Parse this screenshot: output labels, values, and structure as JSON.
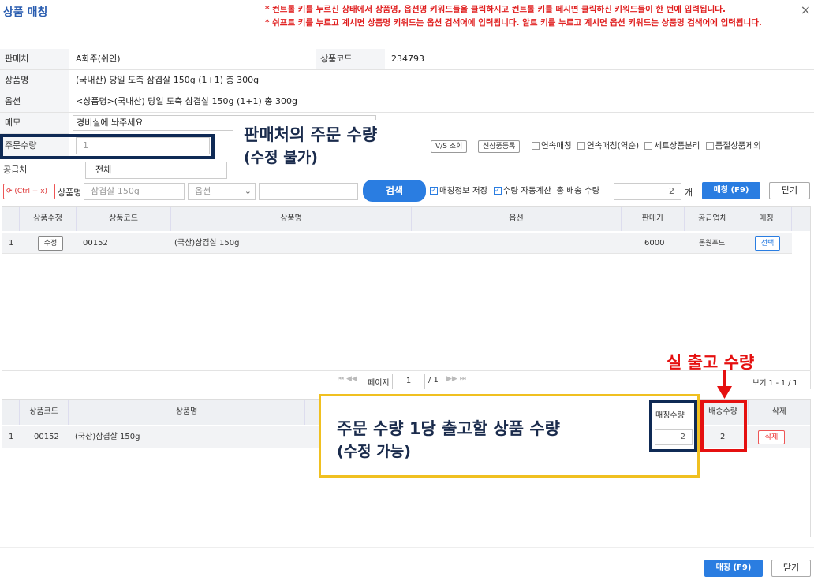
{
  "header": {
    "title": "상품 매칭",
    "notes": [
      "* 컨트롤 키를 누르신 상태에서 상품명, 옵션명 키워드들을 클릭하시고 컨트롤 키를 떼시면 클릭하신 키워드들이 한 번에 입력됩니다.",
      "* 쉬프트 키를 누르고 계시면 상품명 키워드는 옵션 검색어에 입력됩니다. 알트 키를 누르고 계시면 옵션 키워드는 상품명 검색어에 입력됩니다."
    ],
    "close": "×"
  },
  "info": {
    "seller_label": "판매처",
    "seller_value": "A화주(쉬인)",
    "code_label": "상품코드",
    "code_value": "234793",
    "name_label": "상품명",
    "name_value": "(국내산) 당일 도축 삼겹살 150g (1+1) 총 300g",
    "option_label": "옵션",
    "option_value": "<상품명>(국내산) 당일 도축 삼겹살 150g (1+1) 총 300g",
    "memo_label": "메모",
    "memo_value": "경비실에 놔주세요",
    "qty_label": "주문수량",
    "qty_value": "1",
    "supplier_label": "공급처",
    "supplier_value": "전체"
  },
  "toolbar": {
    "refresh": "(Ctrl + x)",
    "name_label": "상품명",
    "name_value": "삼겹살 150g",
    "option_placeholder": "옵션",
    "search": "검색",
    "save_match": "매칭정보 저장",
    "auto_qty": "수량 자동계산",
    "total_label": "총 배송 수량",
    "total_value": "2",
    "unit": "개",
    "match": "매칭 (F9)",
    "close": "닫기",
    "vs": "V/S 조회",
    "new_product": "신상품등록",
    "continuous": "연속매칭",
    "continuous_rev": "연속매칭(역순)",
    "set_split": "세트상품분리",
    "exclude_soldout": "품절상품제외"
  },
  "grid1": {
    "columns": [
      "상품수정",
      "상품코드",
      "상품명",
      "옵션",
      "판매가",
      "공급업체",
      "매칭"
    ],
    "rows": [
      {
        "no": "1",
        "edit": "수정",
        "code": "00152",
        "name": "(국산)삼겹살 150g",
        "option": "",
        "price": "6000",
        "vendor": "동원푸드",
        "select": "선택"
      }
    ],
    "pager": {
      "page_label": "페이지",
      "page": "1",
      "total": "/ 1",
      "range": "보기 1 - 1 / 1"
    }
  },
  "grid2": {
    "columns": [
      "상품코드",
      "상품명",
      "매칭수량",
      "배송수량",
      "삭제"
    ],
    "rows": [
      {
        "no": "1",
        "code": "00152",
        "name": "(국산)삼겹살 150g",
        "match_qty": "2",
        "ship_qty": "2",
        "delete": "삭제"
      }
    ]
  },
  "footer": {
    "match": "매칭 (F9)",
    "close": "닫기"
  },
  "annotations": {
    "qty_note": [
      "판매처의 주문 수량",
      "(수정 불가)"
    ],
    "ship_note": "실 출고 수량",
    "match_note": [
      "주문 수량 1당 출고할 상품 수량",
      "(수정 가능)"
    ]
  }
}
